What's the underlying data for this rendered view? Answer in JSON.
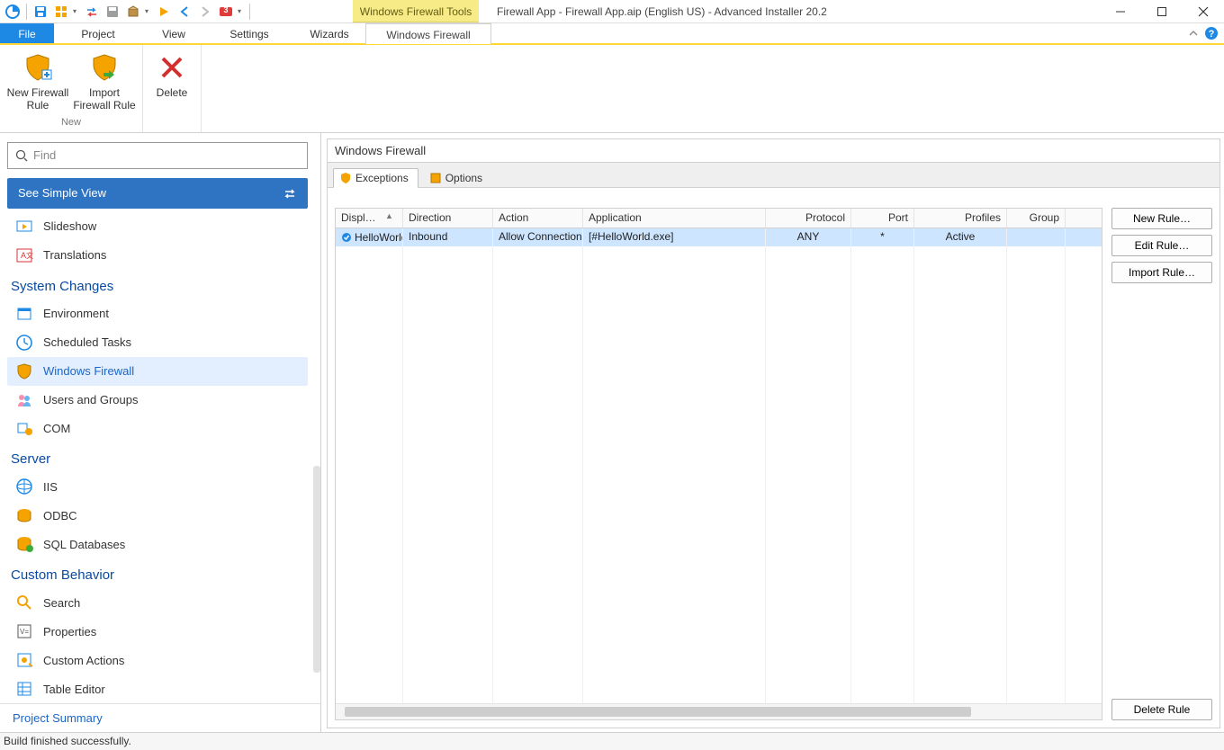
{
  "window": {
    "title": "Firewall App - Firewall App.aip (English US) - Advanced Installer 20.2"
  },
  "context_tab_title": "Windows Firewall Tools",
  "ribbon_tabs": {
    "file": "File",
    "project": "Project",
    "view": "View",
    "settings": "Settings",
    "wizards": "Wizards",
    "windows_firewall": "Windows Firewall"
  },
  "ribbon": {
    "new_rule1": "New Firewall",
    "new_rule2": "Rule",
    "import_rule1": "Import",
    "import_rule2": "Firewall Rule",
    "delete": "Delete",
    "group_new": "New"
  },
  "sidebar": {
    "find_placeholder": "Find",
    "simple_view": "See Simple View",
    "items_top": {
      "slideshow": "Slideshow",
      "translations": "Translations"
    },
    "system_changes": "System Changes",
    "items_sc": {
      "environment": "Environment",
      "scheduled_tasks": "Scheduled Tasks",
      "windows_firewall": "Windows Firewall",
      "users_groups": "Users and Groups",
      "com": "COM"
    },
    "server": "Server",
    "items_server": {
      "iis": "IIS",
      "odbc": "ODBC",
      "sql_databases": "SQL Databases"
    },
    "custom_behavior": "Custom Behavior",
    "items_cb": {
      "search": "Search",
      "properties": "Properties",
      "custom_actions": "Custom Actions",
      "table_editor": "Table Editor"
    },
    "project_summary": "Project Summary"
  },
  "content": {
    "title": "Windows Firewall",
    "tabs": {
      "exceptions": "Exceptions",
      "options": "Options"
    },
    "columns": {
      "display_name": "Displ…",
      "direction": "Direction",
      "action": "Action",
      "application": "Application",
      "protocol": "Protocol",
      "port": "Port",
      "profiles": "Profiles",
      "group": "Group"
    },
    "rows": [
      {
        "name": "HelloWorld",
        "dir": "Inbound",
        "action": "Allow Connection",
        "app": "[#HelloWorld.exe]",
        "proto": "ANY",
        "port": "*",
        "profiles": "Active",
        "group": ""
      }
    ],
    "buttons": {
      "new_rule": "New Rule…",
      "edit_rule": "Edit Rule…",
      "import_rule": "Import Rule…",
      "delete_rule": "Delete Rule"
    }
  },
  "status": "Build finished successfully.",
  "qat_badge": "3"
}
